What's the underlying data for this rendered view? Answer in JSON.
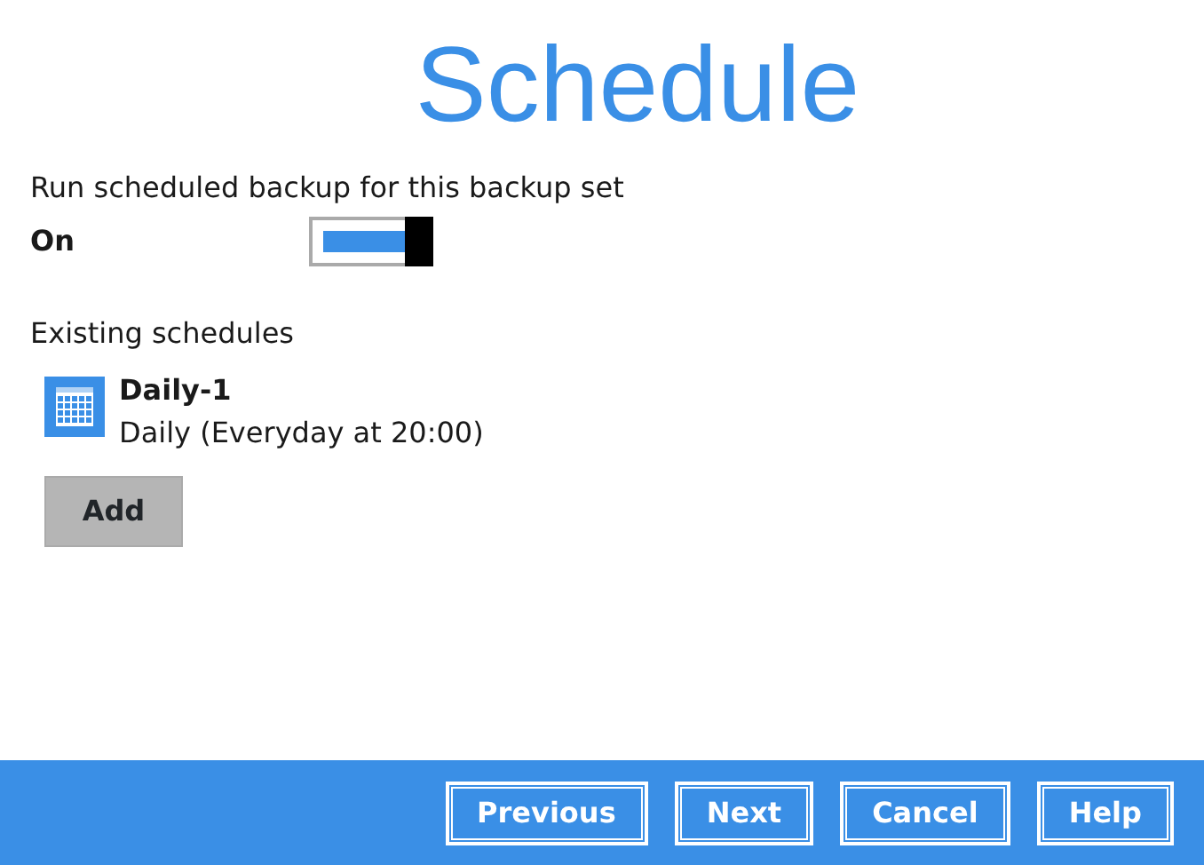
{
  "title": "Schedule",
  "run_setting": {
    "label": "Run scheduled backup for this backup set",
    "state_label": "On",
    "on": true
  },
  "existing_label": "Existing schedules",
  "schedules": [
    {
      "name": "Daily-1",
      "description": "Daily (Everyday at 20:00)"
    }
  ],
  "add_button": "Add",
  "footer_buttons": [
    "Previous",
    "Next",
    "Cancel",
    "Help"
  ]
}
